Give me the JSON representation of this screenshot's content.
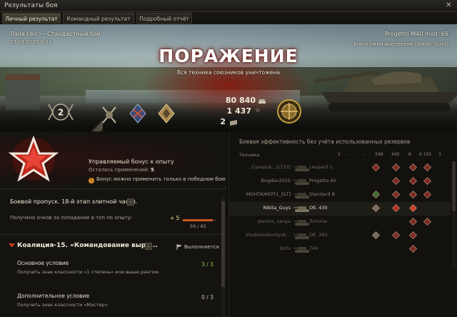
{
  "window": {
    "title": "Результаты боя",
    "close_glyph": "✕"
  },
  "tabs": [
    {
      "label": "Личный результат",
      "active": true
    },
    {
      "label": "Командный результат",
      "active": false
    },
    {
      "label": "Подробный отчёт",
      "active": false
    }
  ],
  "banner": {
    "mode": "Лайв Окс — Стандартный бой",
    "date": "17.04.2020 9:34",
    "tank": "Progetto M40 mod. 65",
    "killed_by": "Уничтожен выстрелом (Nikita_Guys)",
    "result": "ПОРАЖЕНИЕ",
    "reason": "Вся техника союзников уничтожена"
  },
  "earnings": {
    "credits": "80 840",
    "credits_icon": "credits-icon",
    "xp": "1 437",
    "xp_icon": "☆",
    "crystals": "2",
    "crystals_icon": "crystal-icon"
  },
  "rank": {
    "value": "2"
  },
  "bonus": {
    "title": "Управляемый бонус к опыту",
    "uses_label": "Осталось применений:",
    "uses_value": "5",
    "note": "Бонус можно применить только в победном бою"
  },
  "battle_pass": {
    "title": "Боевой пропуск. 18-й этап элитной части.",
    "label": "Получено очков за попадание в топ по опыту:",
    "plus": "+ 5",
    "progress_text": "59 / 65",
    "progress_fraction": 0.9077
  },
  "coalition": {
    "title": "Коалиция-15. «Командование выра...",
    "status": "Выполняется",
    "conditions": [
      {
        "title": "Основное условие",
        "desc": "Получить знак классности «1 степень» или выше рангом.",
        "value": "3 / 3",
        "color": "#8ec64a"
      },
      {
        "title": "Дополнительное условие",
        "desc": "Получить знак классности «Мастер».",
        "value": "0 / 3",
        "color": "#c9c4b2"
      }
    ]
  },
  "efficiency": {
    "title": "Боевая эффективность без учёта использованных резервов",
    "headers": {
      "tech": "Техника",
      "c1": "2",
      "c2": "-",
      "c3": "-",
      "c4": "299",
      "c5": "440",
      "c6": "8",
      "c7": "6 195",
      "c8": "3"
    },
    "rows": [
      {
        "player": "...Cyxapuk...[LT33]",
        "tank": "Leopard 1",
        "dim": true,
        "me": false,
        "player_color": "#6e695c",
        "tank_color": "#6e695c"
      },
      {
        "player": "Bogdan2015",
        "tank": "Progetto 65",
        "dim": true,
        "me": false,
        "player_color": "#8a8474",
        "tank_color": "#8a8474"
      },
      {
        "player": "МОНТАЖЕР[1_SLT]",
        "tank": "Standard B",
        "dim": true,
        "me": false,
        "player_color": "#8a8474",
        "tank_color": "#8a8474"
      },
      {
        "player": "Nikita_Guys",
        "tank": "Об. 430",
        "dim": false,
        "me": true,
        "player_color": "#e4decb",
        "tank_color": "#e4decb"
      },
      {
        "player": "plenkin_sanya",
        "tank": "Tortoise",
        "dim": true,
        "me": false,
        "player_color": "#6e695c",
        "tank_color": "#6e695c"
      },
      {
        "player": "VladislavKorolyuk...",
        "tank": "Об. 283",
        "dim": true,
        "me": false,
        "player_color": "#6e695c",
        "tank_color": "#6e695c"
      },
      {
        "player": "Skris",
        "tank": "T49",
        "dim": true,
        "me": false,
        "player_color": "#6e695c",
        "tank_color": "#6e695c"
      }
    ]
  },
  "colors": {
    "accent_red": "#c83a1c",
    "gold": "#c8a040",
    "green": "#8ec64a"
  }
}
